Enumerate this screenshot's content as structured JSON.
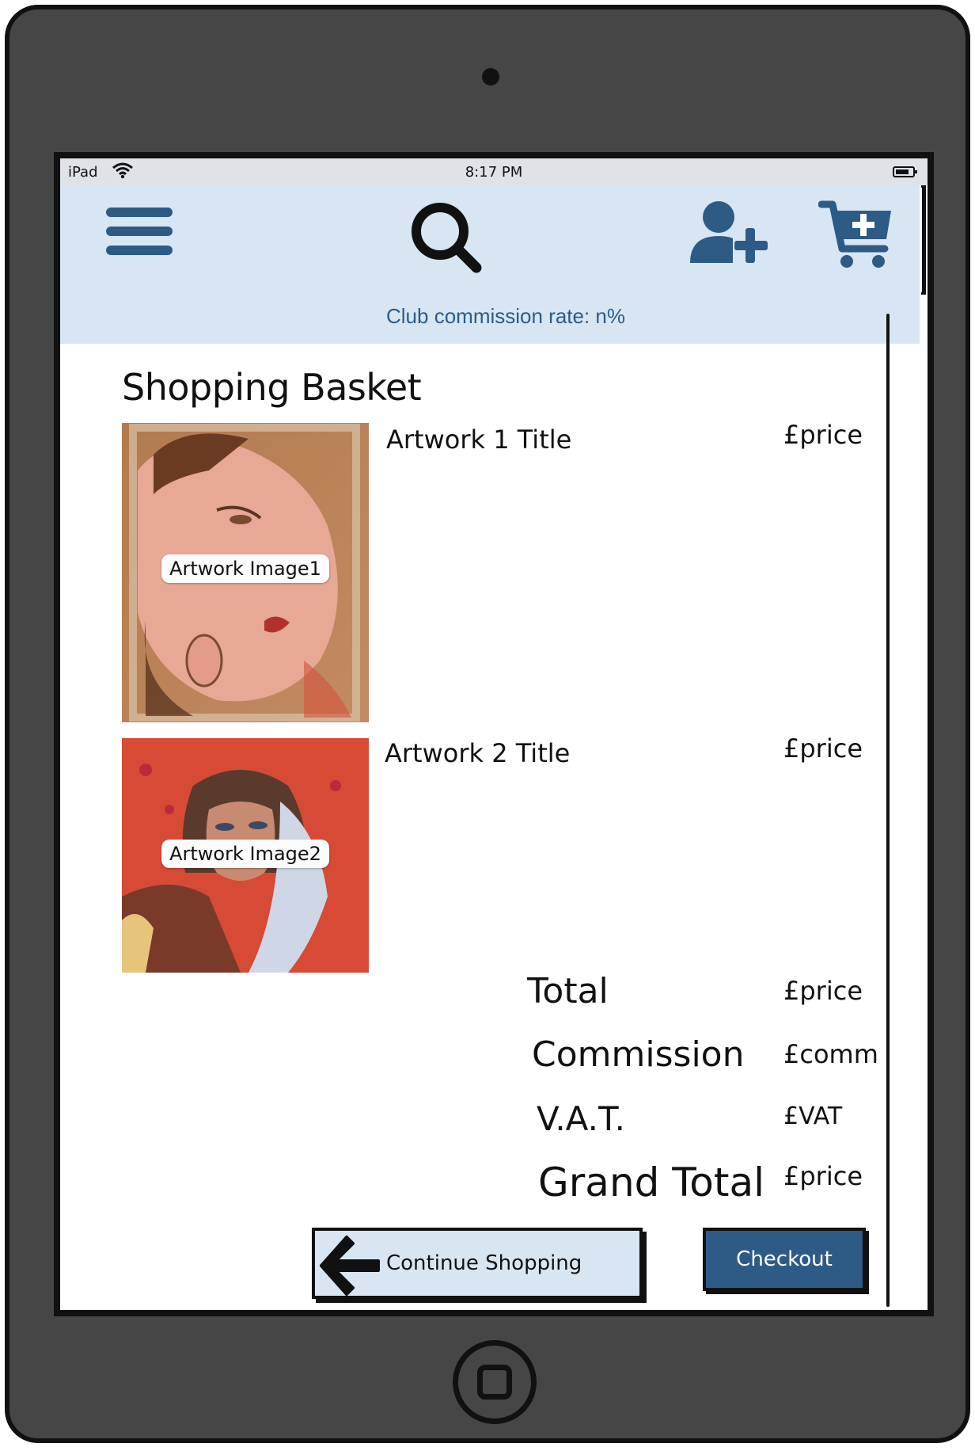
{
  "status_bar": {
    "carrier": "iPad",
    "time": "8:17 PM"
  },
  "header": {
    "menu_icon": "hamburger-menu-icon",
    "search_icon": "search-icon",
    "add_user_icon": "add-user-icon",
    "cart_icon": "cart-add-icon",
    "commission_rate": "Club commission rate: n%"
  },
  "page": {
    "title": "Shopping Basket"
  },
  "items": [
    {
      "image_label": "Artwork Image1",
      "title": "Artwork 1 Title",
      "price": "£price"
    },
    {
      "image_label": "Artwork Image2",
      "title": "Artwork 2 Title",
      "price": "£price"
    }
  ],
  "summary": {
    "total_label": "Total",
    "total_value": "£price",
    "commission_label": "Commission",
    "commission_value": "£comm",
    "vat_label": "V.A.T.",
    "vat_value": "£VAT",
    "grand_total_label": "Grand Total",
    "grand_total_value": "£price"
  },
  "actions": {
    "continue_label": "Continue Shopping",
    "checkout_label": "Checkout"
  },
  "colors": {
    "header_bg": "#d8e6f3",
    "accent": "#2e5b86",
    "device": "#464646"
  }
}
